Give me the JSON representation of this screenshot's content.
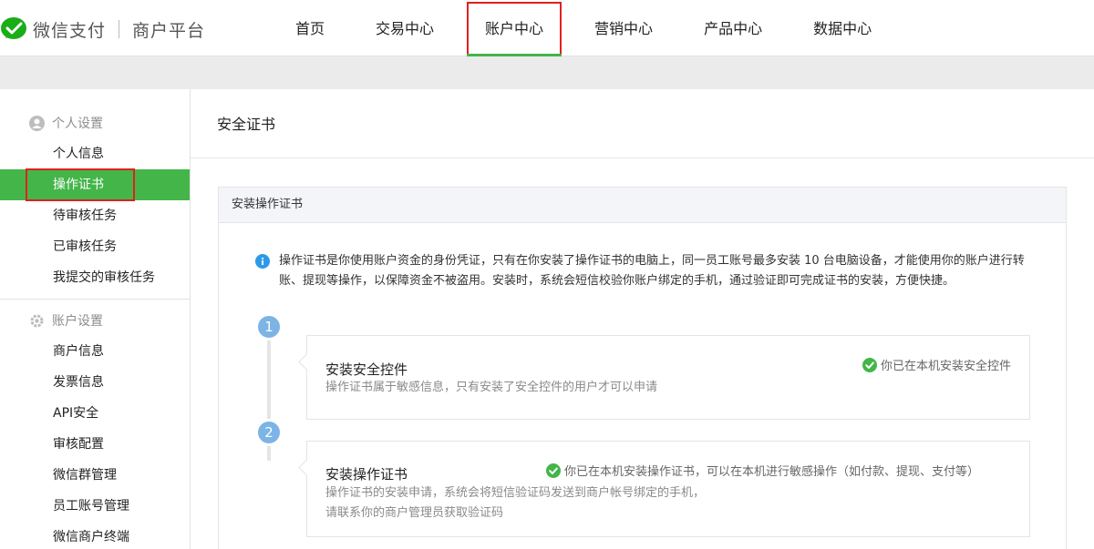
{
  "header": {
    "brand": "微信支付",
    "platform": "商户平台",
    "nav": [
      {
        "label": "首页"
      },
      {
        "label": "交易中心"
      },
      {
        "label": "账户中心"
      },
      {
        "label": "营销中心"
      },
      {
        "label": "产品中心"
      },
      {
        "label": "数据中心"
      }
    ],
    "active_nav": "账户中心"
  },
  "sidebar": {
    "groups": [
      {
        "title": "个人设置",
        "icon": "user-icon",
        "items": [
          "个人信息",
          "操作证书",
          "待审核任务",
          "已审核任务",
          "我提交的审核任务"
        ]
      },
      {
        "title": "账户设置",
        "icon": "gear-icon",
        "items": [
          "商户信息",
          "发票信息",
          "API安全",
          "审核配置",
          "微信群管理",
          "员工账号管理",
          "微信商户终端"
        ]
      }
    ],
    "active_item": "操作证书"
  },
  "main": {
    "page_title": "安全证书",
    "panel_title": "安装操作证书",
    "notice": "操作证书是你使用账户资金的身份凭证，只有在你安装了操作证书的电脑上，同一员工账号最多安装 10 台电脑设备，才能使用你的账户进行转账、提现等操作，以保障资金不被盗用。安装时，系统会短信校验你账户绑定的手机，通过验证即可完成证书的安装，方便快捷。",
    "steps": [
      {
        "num": "1",
        "title": "安装安全控件",
        "desc": "操作证书属于敏感信息，只有安装了安全控件的用户才可以申请",
        "status": "你已在本机安装安全控件"
      },
      {
        "num": "2",
        "title": "安装操作证书",
        "desc_line1": "操作证书的安装申请，系统会将短信验证码发送到商户帐号绑定的手机，",
        "desc_line2": "请联系你的商户管理员获取验证码",
        "status": "你已在本机安装操作证书，可以在本机进行敏感操作（如付款、提现、支付等）"
      }
    ]
  },
  "colors": {
    "brand_green": "#44b549",
    "highlight_red": "#e02020",
    "step_blue": "#7cb4e6",
    "info_blue": "#2d9ae8"
  }
}
